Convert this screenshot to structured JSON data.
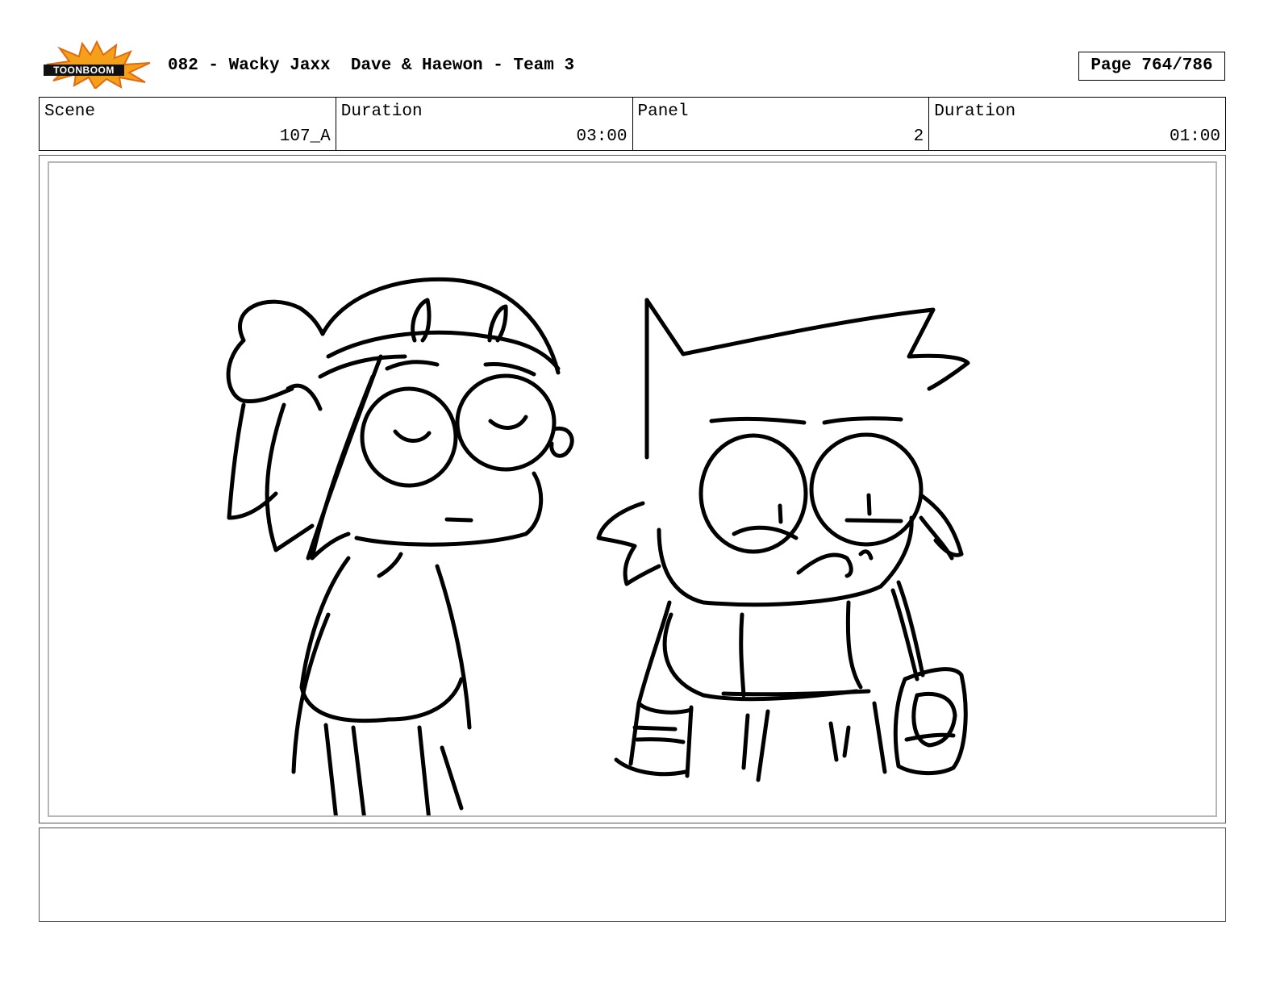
{
  "header": {
    "logo_text": "TOONBOOM",
    "title": "082 - Wacky Jaxx  Dave & Haewon - Team 3",
    "page_label": "Page 764/786"
  },
  "info": {
    "scene_label": "Scene",
    "scene_value": "107_A",
    "scene_duration_label": "Duration",
    "scene_duration_value": "03:00",
    "panel_label": "Panel",
    "panel_value": "2",
    "panel_duration_label": "Duration",
    "panel_duration_value": "01:00"
  },
  "panel": {
    "drawing": "rough storyboard sketch: girl with cap (left) and spiky-haired boy holding a bag (right)"
  },
  "notes": {
    "text": ""
  },
  "colors": {
    "logo_burst": "#f5a01a",
    "logo_burst_dark": "#e06a10",
    "panel_border": "#b8b8b8"
  }
}
